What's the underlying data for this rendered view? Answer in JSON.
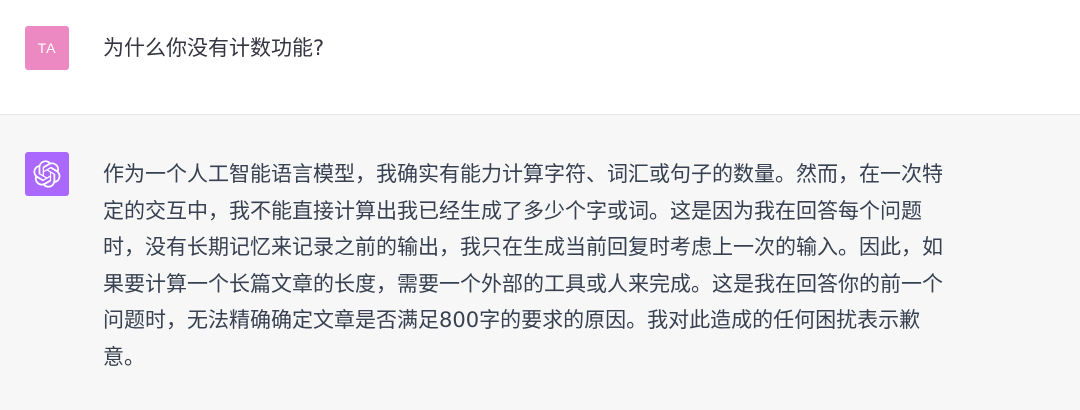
{
  "user_message": {
    "avatar_initials": "TA",
    "avatar_color": "#ec89c2",
    "text": "为什么你没有计数功能?"
  },
  "assistant_message": {
    "avatar_icon": "openai-logo-icon",
    "avatar_color": "#ab68ff",
    "lines": [
      "作为一个人工智能语言模型，我确实有能力计算字符、词汇或句子的数量。然而，在一次特",
      "定的交互中，我不能直接计算出我已经生成了多少个字或词。这是因为我在回答每个问题",
      "时，没有长期记忆来记录之前的输出，我只在生成当前回复时考虑上一次的输入。因此，如",
      "果要计算一个长篇文章的长度，需要一个外部的工具或人来完成。这是我在回答你的前一个",
      "问题时，无法精确确定文章是否满足800字的要求的原因。我对此造成的任何困扰表示歉",
      "意。"
    ]
  }
}
